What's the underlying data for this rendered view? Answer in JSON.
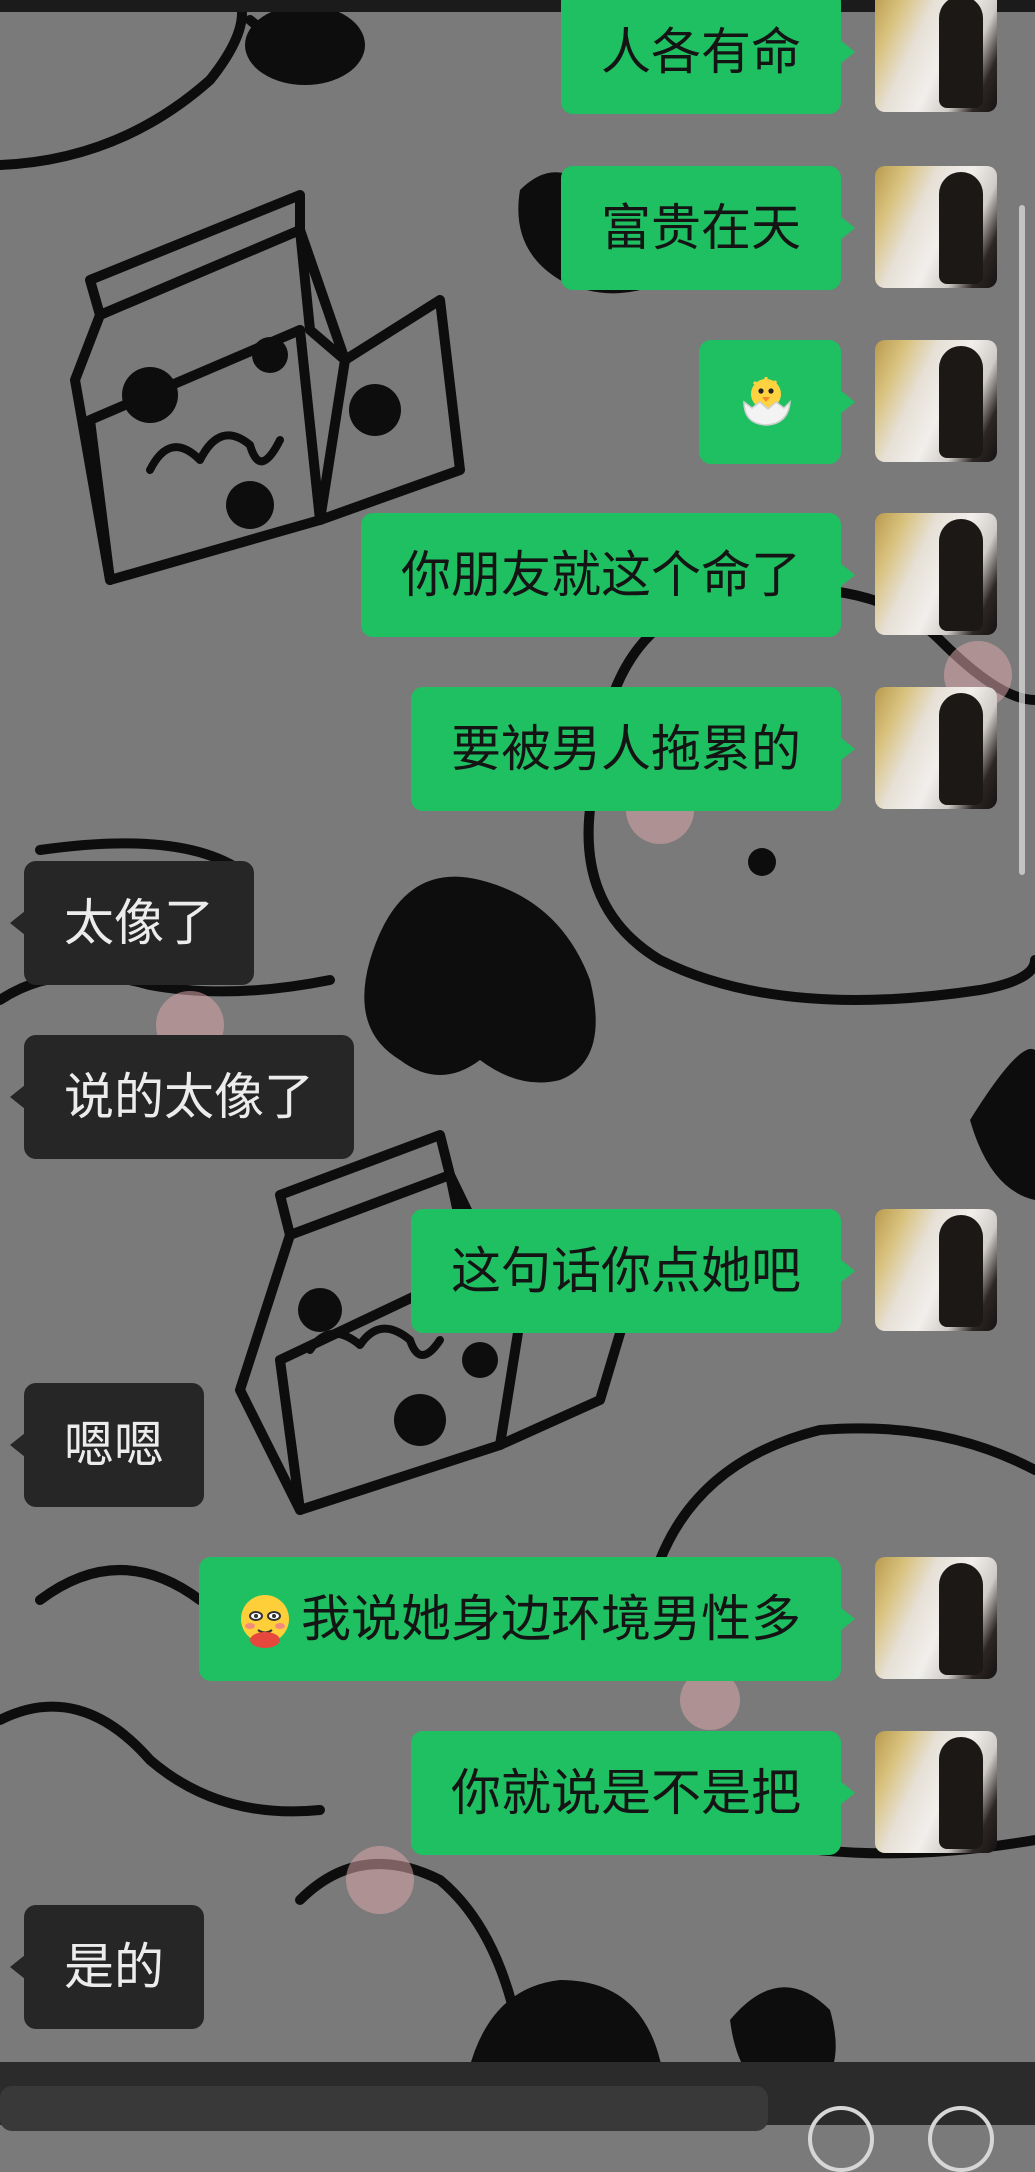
{
  "chat": {
    "messages": [
      {
        "side": "out",
        "text": "人各有命"
      },
      {
        "side": "out",
        "text": "富贵在天"
      },
      {
        "side": "out",
        "emoji": "hatching-chick"
      },
      {
        "side": "out",
        "text": "你朋友就这个命了"
      },
      {
        "side": "out",
        "text": "要被男人拖累的"
      },
      {
        "side": "in",
        "text": "太像了"
      },
      {
        "side": "in",
        "text": "说的太像了"
      },
      {
        "side": "out",
        "text": "这句话你点她吧"
      },
      {
        "side": "in",
        "text": "嗯嗯"
      },
      {
        "side": "out",
        "emoji": "pleading-blush-face",
        "text": "我说她身边环境男性多"
      },
      {
        "side": "out",
        "text": "你就说是不是把"
      },
      {
        "side": "in",
        "text": "是的"
      }
    ]
  },
  "colors": {
    "outgoing_bubble": "#1fc062",
    "incoming_bubble": "#262626",
    "wallpaper": "#7a7a7a",
    "input_bar": "#2b2b2b"
  }
}
